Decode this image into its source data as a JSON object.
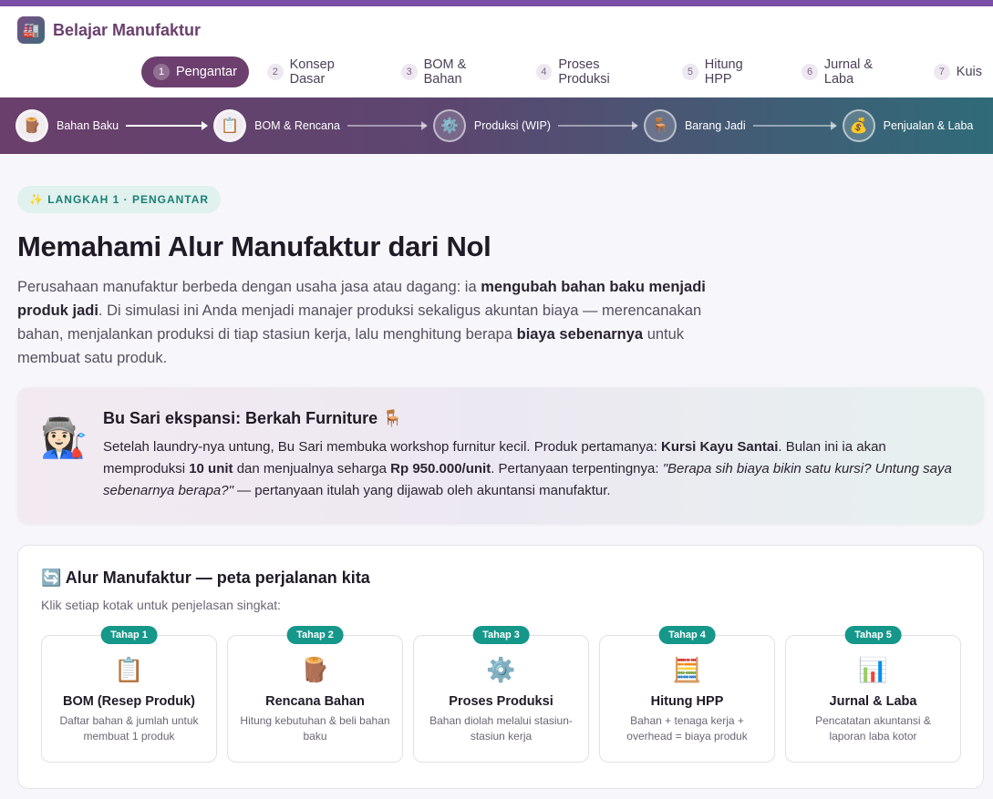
{
  "app": {
    "brand_icon": "factory-icon",
    "brand_name": "Belajar Manufaktur"
  },
  "nav": {
    "tabs": [
      {
        "num": "1",
        "label": "Pengantar",
        "active": true
      },
      {
        "num": "2",
        "label": "Konsep Dasar"
      },
      {
        "num": "3",
        "label": "BOM & Bahan"
      },
      {
        "num": "4",
        "label": "Proses Produksi"
      },
      {
        "num": "5",
        "label": "Hitung HPP"
      },
      {
        "num": "6",
        "label": "Jurnal & Laba"
      },
      {
        "num": "7",
        "label": "Kuis"
      }
    ]
  },
  "flow": {
    "steps": [
      {
        "icon": "🪵",
        "icon_name": "wood-log-icon",
        "label": "Bahan Baku"
      },
      {
        "icon": "📋",
        "icon_name": "clipboard-icon",
        "label": "BOM & Rencana"
      },
      {
        "icon": "⚙️",
        "icon_name": "gear-icon",
        "label": "Produksi (WIP)"
      },
      {
        "icon": "🪑",
        "icon_name": "chair-icon",
        "label": "Barang Jadi"
      },
      {
        "icon": "💰",
        "icon_name": "money-bag-icon",
        "label": "Penjualan & Laba"
      }
    ]
  },
  "main": {
    "pill": "✨ LANGKAH 1 · PENGANTAR",
    "title": "Memahami Alur Manufaktur dari Nol",
    "intro": {
      "p1": "Perusahaan manufaktur berbeda dengan usaha jasa atau dagang: ia ",
      "b1": "mengubah bahan baku menjadi produk jadi",
      "p2": ". Di simulasi ini Anda menjadi manajer produksi sekaligus akuntan biaya — merencanakan bahan, menjalankan produksi di tiap stasiun kerja, lalu menghitung berapa ",
      "b2": "biaya sebenarnya",
      "p3": " untuk membuat satu produk."
    }
  },
  "story": {
    "avatar": "👩🏻‍🏭",
    "title": "Bu Sari ekspansi: Berkah Furniture 🪑",
    "t1": "Setelah laundry-nya untung, Bu Sari membuka workshop furnitur kecil. Produk pertamanya: ",
    "b1": "Kursi Kayu Santai",
    "t2": ". Bulan ini ia akan memproduksi ",
    "b2": "10 unit",
    "t3": " dan menjualnya seharga ",
    "b3": "Rp 950.000/unit",
    "t4": ". Pertanyaan terpentingnya: ",
    "i1": "\"Berapa sih biaya bikin satu kursi? Untung saya sebenarnya berapa?\"",
    "t5": " — pertanyaan itulah yang dijawab oleh akuntansi manufaktur."
  },
  "alur": {
    "title": "🔄 Alur Manufaktur — peta perjalanan kita",
    "subtitle": "Klik setiap kotak untuk penjelasan singkat:",
    "stages": [
      {
        "badge": "Tahap 1",
        "icon": "📋",
        "icon_name": "clipboard-icon",
        "name": "BOM (Resep Produk)",
        "desc": "Daftar bahan & jumlah untuk membuat 1 produk"
      },
      {
        "badge": "Tahap 2",
        "icon": "🪵",
        "icon_name": "wood-log-icon",
        "name": "Rencana Bahan",
        "desc": "Hitung kebutuhan & beli bahan baku"
      },
      {
        "badge": "Tahap 3",
        "icon": "⚙️",
        "icon_name": "gear-icon",
        "name": "Proses Produksi",
        "desc": "Bahan diolah melalui stasiun-stasiun kerja"
      },
      {
        "badge": "Tahap 4",
        "icon": "🧮",
        "icon_name": "abacus-icon",
        "name": "Hitung HPP",
        "desc": "Bahan + tenaga kerja + overhead = biaya produk"
      },
      {
        "badge": "Tahap 5",
        "icon": "📊",
        "icon_name": "bar-chart-icon",
        "name": "Jurnal & Laba",
        "desc": "Pencatatan akuntansi & laporan laba kotor"
      }
    ]
  }
}
